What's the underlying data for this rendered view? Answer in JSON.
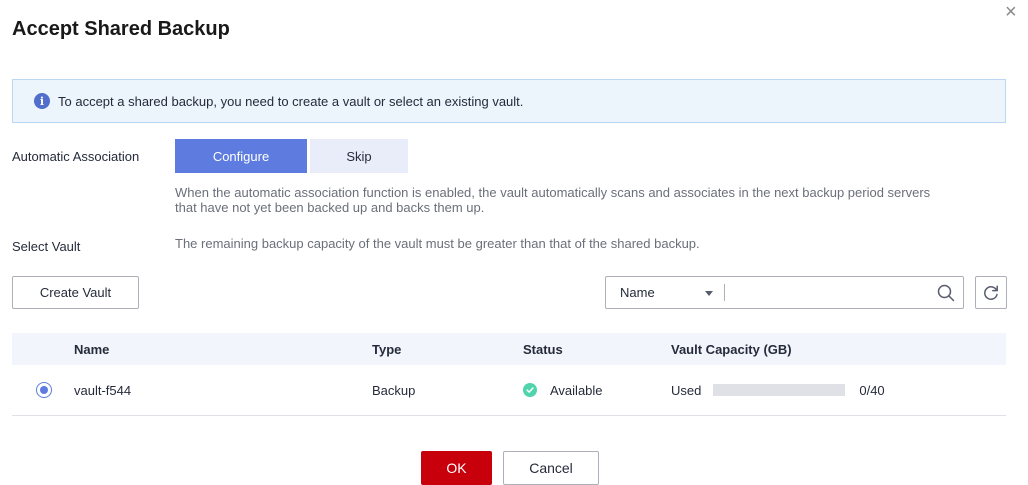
{
  "dialog": {
    "title": "Accept Shared Backup",
    "close_icon": "close-icon",
    "close_glyph": "×"
  },
  "info": {
    "icon": "info-icon",
    "icon_glyph": "i",
    "text": "To accept a shared backup, you need to create a vault or select an existing vault."
  },
  "association": {
    "label": "Automatic Association",
    "options": [
      "Configure",
      "Skip"
    ],
    "selected": "Configure",
    "hint_line1": "When the automatic association function is enabled, the vault automatically scans and associates in the next backup period servers",
    "hint_line2": "that have not yet been backed up and backs them up."
  },
  "select_vault": {
    "label": "Select Vault",
    "hint": "The remaining backup capacity of the vault must be greater than that of the shared backup."
  },
  "toolbar": {
    "create_vault_label": "Create Vault",
    "search_field_selected": "Name",
    "search_placeholder": "",
    "search_icon": "search-icon",
    "refresh_icon": "refresh-icon"
  },
  "table": {
    "columns": [
      "Name",
      "Type",
      "Status",
      "Vault Capacity (GB)"
    ],
    "rows": [
      {
        "selected": true,
        "name": "vault-f544",
        "type": "Backup",
        "status": "Available",
        "used_label": "Used",
        "used_fraction": 0,
        "capacity": "0/40"
      }
    ]
  },
  "footer": {
    "ok_label": "OK",
    "cancel_label": "Cancel"
  },
  "colors": {
    "primary": "#5e7ce0",
    "ok": "#c7000b",
    "available": "#50d4ab",
    "info_bg": "#ecf4fc"
  }
}
